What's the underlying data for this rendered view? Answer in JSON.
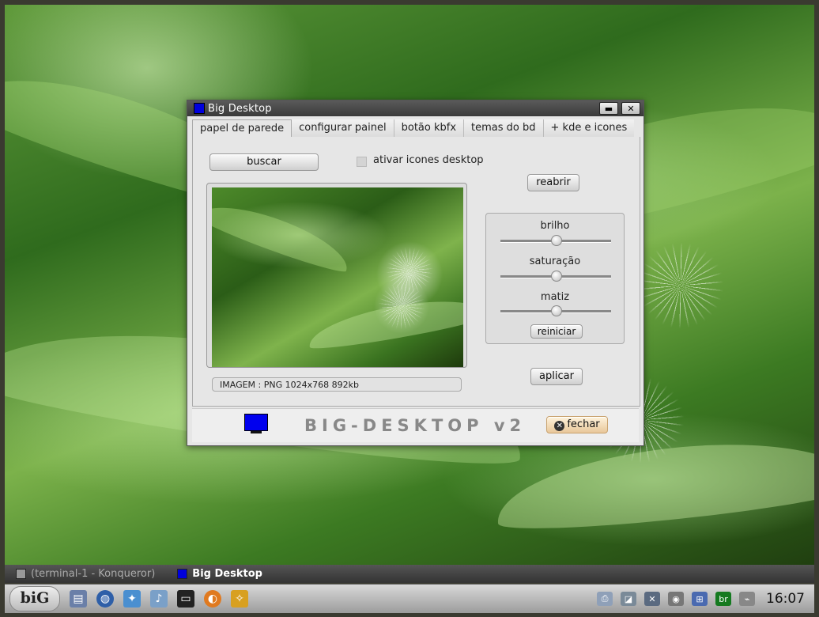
{
  "window": {
    "title": "Big Desktop",
    "minimize_glyph": "▬",
    "close_glyph": "✕"
  },
  "tabs": [
    {
      "label": "papel de parede"
    },
    {
      "label": "configurar painel"
    },
    {
      "label": "botão kbfx"
    },
    {
      "label": "temas do bd"
    },
    {
      "label": "+ kde e icones"
    }
  ],
  "wallpaper_tab": {
    "buscar_label": "buscar",
    "checkbox_label": "ativar icones desktop",
    "reabrir_label": "reabrir",
    "image_info": "IMAGEM : PNG 1024x768 892kb",
    "sliders": [
      {
        "label": "brilho",
        "value": 0.5
      },
      {
        "label": "saturação",
        "value": 0.5
      },
      {
        "label": "matiz",
        "value": 0.5
      }
    ],
    "reiniciar_label": "reiniciar",
    "aplicar_label": "aplicar"
  },
  "footer": {
    "brand": "BIG-DESKTOP v2",
    "fechar_label": "fechar",
    "accent_color": "#0000ee"
  },
  "taskbar": {
    "items": [
      {
        "label": "(terminal-1 - Konqueror)",
        "state": "inactive"
      },
      {
        "label": "Big Desktop",
        "state": "active"
      }
    ]
  },
  "panel": {
    "logo": "biG",
    "clock": "16:07",
    "tray_badge": "br"
  }
}
